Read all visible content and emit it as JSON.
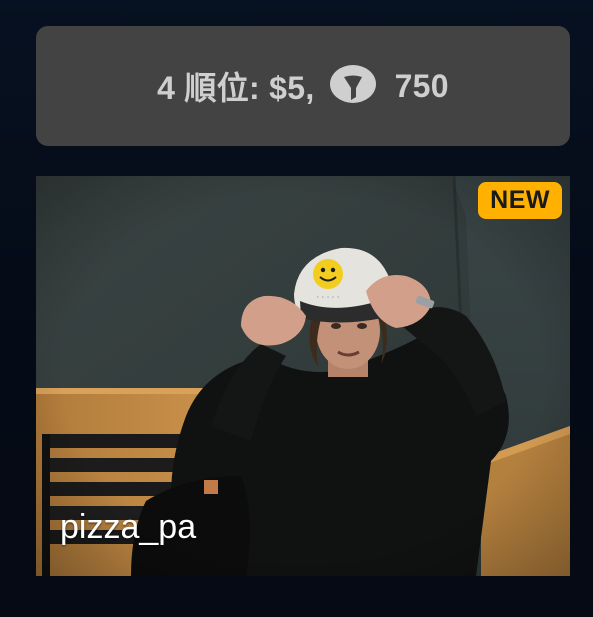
{
  "rank_card": {
    "prefix_text": "4 順位: $5,",
    "comment_icon": "comment-bubble-icon",
    "count": "750"
  },
  "photo_card": {
    "badge": "NEW",
    "username": "pizza_pa"
  },
  "colors": {
    "background": "#061121",
    "card": "#434343",
    "card_text": "#cfcfcf",
    "badge": "#ffb000"
  }
}
